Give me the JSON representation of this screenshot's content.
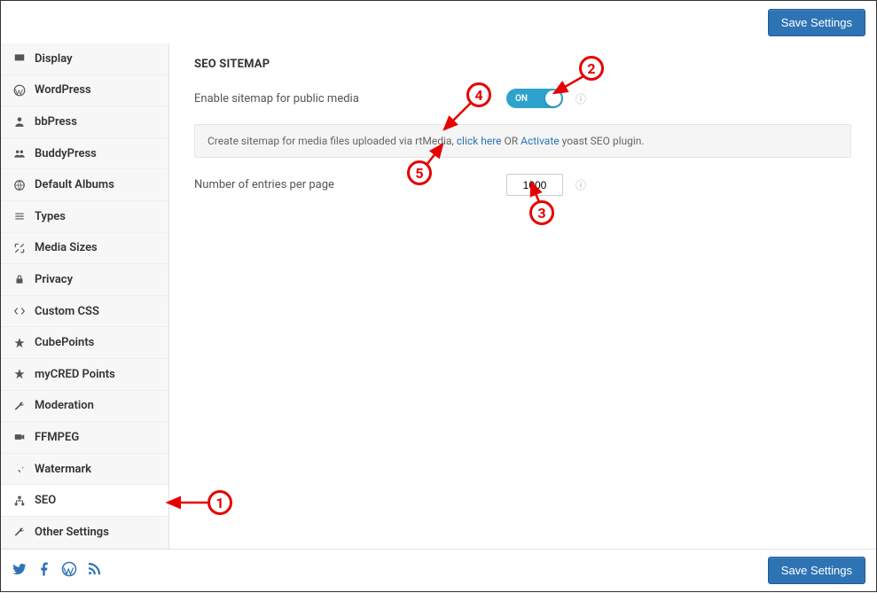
{
  "topbar": {
    "save_label": "Save Settings"
  },
  "sidebar": {
    "items": [
      {
        "label": "Display",
        "icon": "monitor"
      },
      {
        "label": "WordPress",
        "icon": "wordpress"
      },
      {
        "label": "bbPress",
        "icon": "person"
      },
      {
        "label": "BuddyPress",
        "icon": "group"
      },
      {
        "label": "Default Albums",
        "icon": "globe"
      },
      {
        "label": "Types",
        "icon": "sliders"
      },
      {
        "label": "Media Sizes",
        "icon": "expand"
      },
      {
        "label": "Privacy",
        "icon": "lock"
      },
      {
        "label": "Custom CSS",
        "icon": "code"
      },
      {
        "label": "CubePoints",
        "icon": "star"
      },
      {
        "label": "myCRED Points",
        "icon": "star"
      },
      {
        "label": "Moderation",
        "icon": "wrench"
      },
      {
        "label": "FFMPEG",
        "icon": "video"
      },
      {
        "label": "Watermark",
        "icon": "pin"
      },
      {
        "label": "SEO",
        "icon": "sitemap",
        "active": true
      },
      {
        "label": "Other Settings",
        "icon": "wrench"
      }
    ]
  },
  "seo": {
    "section_title": "SEO SITEMAP",
    "enable_label": "Enable sitemap for public media",
    "toggle_on_text": "ON",
    "notice_prefix": "Create sitemap for media files uploaded via rtMedia, ",
    "click_here": "click here",
    "or_text": " OR ",
    "activate": "Activate",
    "notice_suffix": " yoast SEO plugin.",
    "entries_label": "Number of entries per page",
    "entries_value": "1000"
  },
  "footer": {
    "save_label": "Save Settings"
  },
  "annotations": {
    "1": "1",
    "2": "2",
    "3": "3",
    "4": "4",
    "5": "5"
  }
}
